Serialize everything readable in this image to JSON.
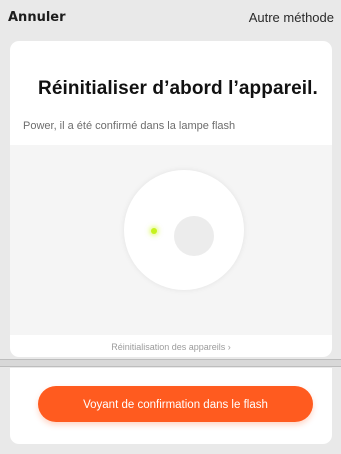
{
  "header": {
    "cancel_label": "Annuler",
    "other_method_label": "Autre méthode"
  },
  "card": {
    "title": "Réinitialiser d’abord l’appareil.",
    "subtitle": "Power, il a été confirmé dans la lampe flash",
    "help_link": "Réinitialisation des appareils ›"
  },
  "footer": {
    "confirm_button_label": "Voyant de confirmation dans le flash"
  },
  "colors": {
    "accent": "#ff5b1f",
    "led": "#c6f21d",
    "background": "#e9e9e9"
  }
}
